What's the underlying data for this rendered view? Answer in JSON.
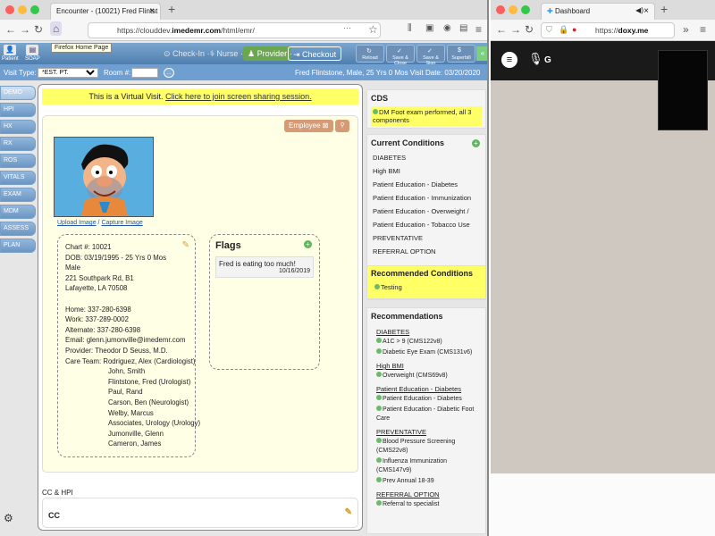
{
  "left_browser": {
    "tab_title": "Encounter - (10021) Fred Flintst",
    "url_prefix": "https://clouddev.",
    "url_domain": "imedemr.com",
    "url_path": "/html/emr/",
    "tooltip": "Firefox Home Page"
  },
  "emr_toolbar": {
    "patient": "Patient",
    "soap": "SOAP",
    "checkin": "Check-In",
    "nurse": "Nurse",
    "provider": "Provider",
    "checkout": "Checkout",
    "reload": "Reload",
    "save_close": "Save & Close",
    "save_sign": "Save & Sign",
    "superbill": "Superbill"
  },
  "visit_bar": {
    "visit_type_label": "Visit Type:",
    "visit_type_value": "*EST. PT.",
    "room_label": "Room #:",
    "patient_summary": "Fred Flintstone, Male, 25 Yrs 0 Mos  Visit Date: 03/20/2020"
  },
  "left_nav": [
    "DEMO",
    "HPI",
    "HX",
    "RX",
    "ROS",
    "VITALS",
    "EXAM",
    "MDM",
    "ASSESS",
    "PLAN"
  ],
  "virtual_banner": {
    "text": "This is a Virtual Visit. ",
    "link": "Click here to join screen sharing session."
  },
  "demo": {
    "employee": "Employee",
    "upload": "Upload Image",
    "sep": " / ",
    "capture": "Capture Image",
    "lines": [
      "Chart #: 10021",
      "DOB: 03/19/1995 - 25 Yrs 0 Mos",
      "Male",
      "221 Southpark Rd, B1",
      "Lafayette, LA 70508",
      "",
      "Home: 337-280-6398",
      "Work: 337-289-0002",
      "Alternate: 337-280-6398",
      "Email: glenn.jumonville@imedemr.com",
      "Provider: Theodor D Seuss, M.D.",
      "Care Team: Rodriguez, Alex (Cardiologist)"
    ],
    "care_team_more": [
      "John, Smith",
      "Flintstone, Fred (Urologist)",
      "Paul, Rand",
      "Carson, Ben (Neurologist)",
      "Welby, Marcus",
      "Associates, Urology (Urology)",
      "Jumonville, Glenn",
      "Cameron, James"
    ]
  },
  "flags": {
    "title": "Flags",
    "items": [
      {
        "text": "Fred is eating too much!",
        "date": "10/16/2019"
      }
    ]
  },
  "cc": {
    "section": "CC & HPI",
    "box_label": "CC"
  },
  "cds": {
    "title": "CDS",
    "item": "DM Foot exam performed, all 3 components"
  },
  "current_conditions": {
    "title": "Current Conditions",
    "items": [
      "DIABETES",
      "High BMI",
      "Patient Education - Diabetes",
      "Patient Education - Immunization",
      "Patient Education - Overweight /",
      "Patient Education - Tobacco Use",
      "PREVENTATIVE",
      "REFERRAL OPTION"
    ]
  },
  "recommended_conditions": {
    "title": "Recommended Conditions",
    "items": [
      "Testing"
    ]
  },
  "recommendations": {
    "title": "Recommendations",
    "groups": [
      {
        "name": "DIABETES",
        "items": [
          "A1C > 9 (CMS122v8)",
          "Diabetic Eye Exam (CMS131v6)"
        ]
      },
      {
        "name": "High BMI",
        "items": [
          "Overweight (CMS69v8)"
        ]
      },
      {
        "name": "Patient Education - Diabetes",
        "items": [
          "Patient Education - Diabetes",
          "Patient Education - Diabetic Foot Care"
        ]
      },
      {
        "name": "PREVENTATIVE",
        "items": [
          "Blood Pressure Screening (CMS22v8)",
          "Influenza Immunization (CMS147v9)",
          "Prev Annual 18-39"
        ]
      },
      {
        "name": "REFERRAL OPTION",
        "items": [
          "Referral to specialist"
        ]
      }
    ]
  },
  "right_browser": {
    "tab_title": "Dashboard",
    "url_prefix": "https://",
    "url_domain": "doxy.me",
    "user_initial": "G"
  }
}
